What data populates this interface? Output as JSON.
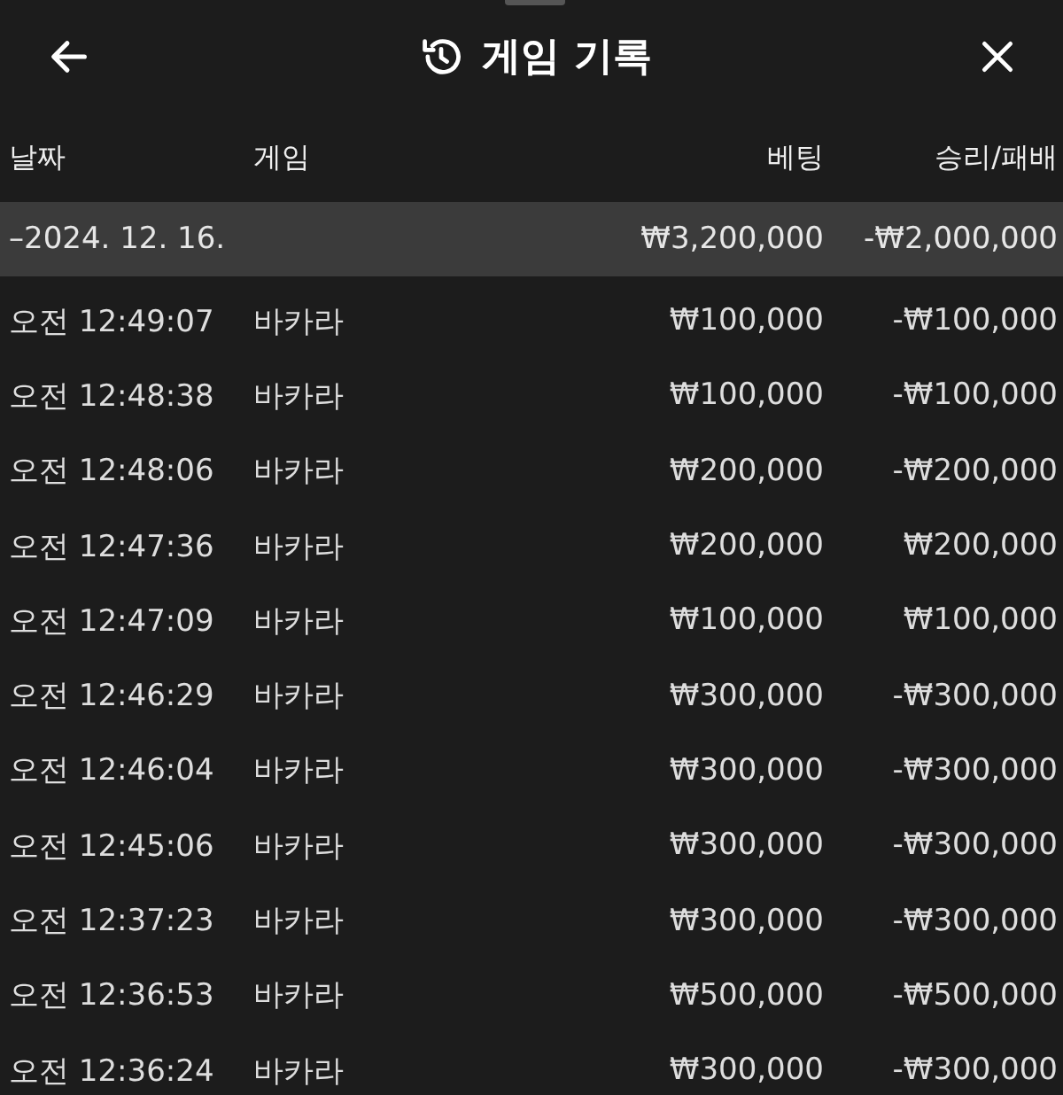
{
  "header": {
    "title": "게임 기록"
  },
  "columns": [
    "날짜",
    "게임",
    "베팅",
    "승리/패배"
  ],
  "summary": {
    "date": "–2024. 12. 16.",
    "bet": "₩3,200,000",
    "result": "-₩2,000,000"
  },
  "rows": [
    {
      "time": "오전 12:49:07",
      "game": "바카라",
      "bet": "₩100,000",
      "result": "-₩100,000"
    },
    {
      "time": "오전 12:48:38",
      "game": "바카라",
      "bet": "₩100,000",
      "result": "-₩100,000"
    },
    {
      "time": "오전 12:48:06",
      "game": "바카라",
      "bet": "₩200,000",
      "result": "-₩200,000"
    },
    {
      "time": "오전 12:47:36",
      "game": "바카라",
      "bet": "₩200,000",
      "result": "₩200,000"
    },
    {
      "time": "오전 12:47:09",
      "game": "바카라",
      "bet": "₩100,000",
      "result": "₩100,000"
    },
    {
      "time": "오전 12:46:29",
      "game": "바카라",
      "bet": "₩300,000",
      "result": "-₩300,000"
    },
    {
      "time": "오전 12:46:04",
      "game": "바카라",
      "bet": "₩300,000",
      "result": "-₩300,000"
    },
    {
      "time": "오전 12:45:06",
      "game": "바카라",
      "bet": "₩300,000",
      "result": "-₩300,000"
    },
    {
      "time": "오전 12:37:23",
      "game": "바카라",
      "bet": "₩300,000",
      "result": "-₩300,000"
    },
    {
      "time": "오전 12:36:53",
      "game": "바카라",
      "bet": "₩500,000",
      "result": "-₩500,000"
    },
    {
      "time": "오전 12:36:24",
      "game": "바카라",
      "bet": "₩300,000",
      "result": "-₩300,000"
    }
  ]
}
